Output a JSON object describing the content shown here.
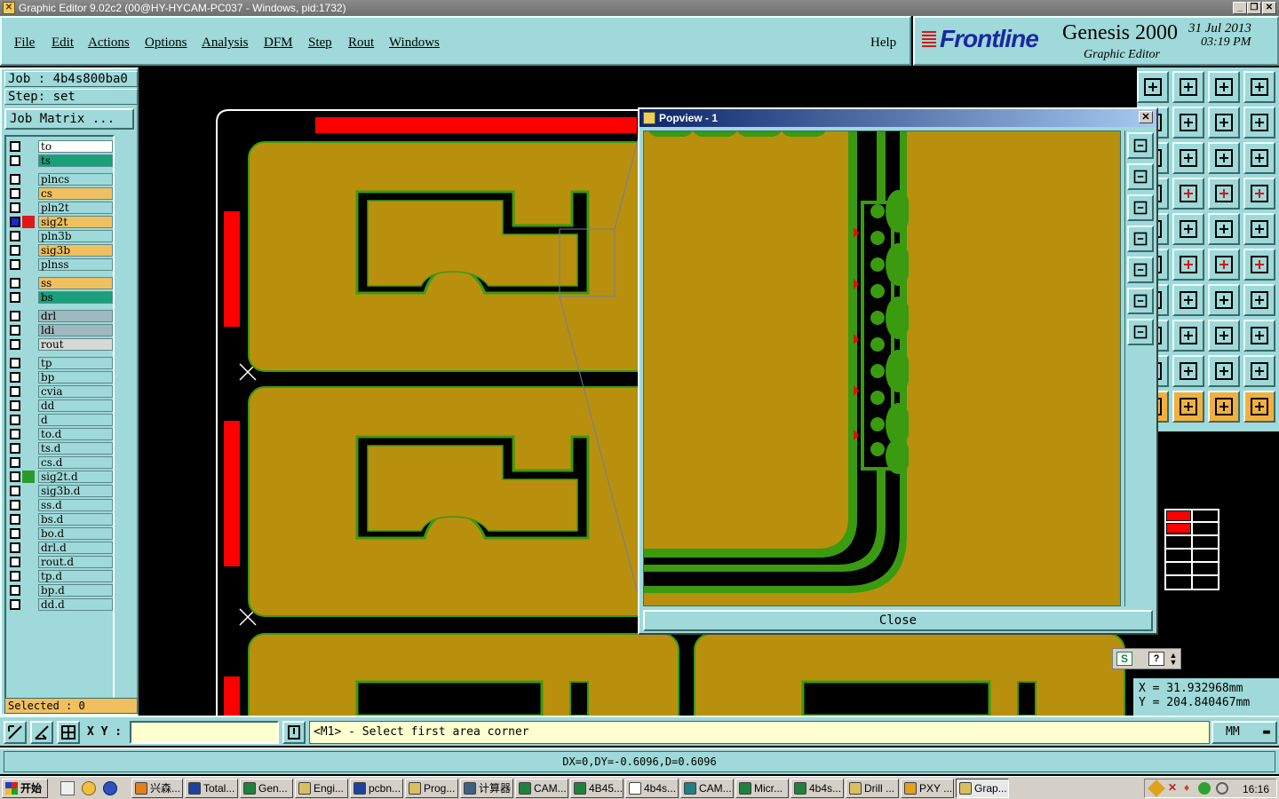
{
  "window": {
    "title": "Graphic Editor 9.02c2 (00@HY-HYCAM-PC037 - Windows, pid:1732)"
  },
  "menu": {
    "items": [
      {
        "label": "File"
      },
      {
        "label": "Edit"
      },
      {
        "label": "Actions"
      },
      {
        "label": "Options"
      },
      {
        "label": "Analysis"
      },
      {
        "label": "DFM"
      },
      {
        "label": "Step"
      },
      {
        "label": "Rout"
      },
      {
        "label": "Windows"
      }
    ],
    "help": "Help"
  },
  "brand": {
    "logo": "Frontline",
    "product": "Genesis 2000",
    "subtitle": "Graphic Editor",
    "date": "31 Jul 2013",
    "time": "03:19 PM"
  },
  "job": {
    "job_line": "Job : 4b4s800ba0",
    "step_line": "Step: set",
    "matrix_button": "Job Matrix ..."
  },
  "layers": [
    {
      "name": "to",
      "color": "#ffffff"
    },
    {
      "name": "ts",
      "color": "#1aa07a"
    },
    {
      "name": "plncs",
      "color": "#9fd9d9"
    },
    {
      "name": "cs",
      "color": "#f0c060"
    },
    {
      "name": "pln2t",
      "color": "#9fd9d9"
    },
    {
      "name": "sig2t",
      "color": "#f0c060"
    },
    {
      "name": "pln3b",
      "color": "#9fd9d9"
    },
    {
      "name": "sig3b",
      "color": "#f0c060"
    },
    {
      "name": "plnss",
      "color": "#9fd9d9"
    },
    {
      "name": "ss",
      "color": "#f0c060"
    },
    {
      "name": "bs",
      "color": "#1aa07a"
    },
    {
      "name": "drl",
      "color": "#a0b8c0"
    },
    {
      "name": "ldi",
      "color": "#a0b8c0"
    },
    {
      "name": "rout",
      "color": "#d8d8d8"
    },
    {
      "name": "tp",
      "color": "#9fd9d9"
    },
    {
      "name": "bp",
      "color": "#9fd9d9"
    },
    {
      "name": "cvia",
      "color": "#9fd9d9"
    },
    {
      "name": "dd",
      "color": "#9fd9d9"
    },
    {
      "name": "d",
      "color": "#9fd9d9"
    },
    {
      "name": "to.d",
      "color": "#9fd9d9"
    },
    {
      "name": "ts.d",
      "color": "#9fd9d9"
    },
    {
      "name": "cs.d",
      "color": "#9fd9d9"
    },
    {
      "name": "sig2t.d",
      "color": "#9fd9d9"
    },
    {
      "name": "sig3b.d",
      "color": "#9fd9d9"
    },
    {
      "name": "ss.d",
      "color": "#9fd9d9"
    },
    {
      "name": "bs.d",
      "color": "#9fd9d9"
    },
    {
      "name": "bo.d",
      "color": "#9fd9d9"
    },
    {
      "name": "drl.d",
      "color": "#9fd9d9"
    },
    {
      "name": "rout.d",
      "color": "#9fd9d9"
    },
    {
      "name": "tp.d",
      "color": "#9fd9d9"
    },
    {
      "name": "bp.d",
      "color": "#9fd9d9"
    },
    {
      "name": "dd.d",
      "color": "#9fd9d9"
    }
  ],
  "selected": "Selected : 0",
  "popview": {
    "title": "Popview - 1",
    "close_label": "Close"
  },
  "coords": {
    "x": "X  = 31.932968mm",
    "y": "Y  = 204.840467mm"
  },
  "command": {
    "xy_label": "X Y :",
    "xy_value": "",
    "prompt": "<M1> - Select first area corner",
    "units": "MM"
  },
  "measure": "DX=0,DY=-0.6096,D=0.6096",
  "taskbar": {
    "start": "开始",
    "tasks": [
      {
        "label": "兴森...",
        "color": "#e08020"
      },
      {
        "label": "Total...",
        "color": "#2040a0"
      },
      {
        "label": "Gen...",
        "color": "#208040"
      },
      {
        "label": "Engi...",
        "color": "#d8c060"
      },
      {
        "label": "pcbn...",
        "color": "#2040a0"
      },
      {
        "label": "Prog...",
        "color": "#d8c060"
      },
      {
        "label": "计算器",
        "color": "#406080"
      },
      {
        "label": "CAM...",
        "color": "#208040"
      },
      {
        "label": "4B45...",
        "color": "#208040"
      },
      {
        "label": "4b4s...",
        "color": "#ffffff"
      },
      {
        "label": "CAM...",
        "color": "#208080"
      },
      {
        "label": "Micr...",
        "color": "#208040"
      },
      {
        "label": "4b4s...",
        "color": "#208040"
      },
      {
        "label": "Drill ...",
        "color": "#d8c060"
      },
      {
        "label": "PXY ...",
        "color": "#e0a020"
      },
      {
        "label": "Grap...",
        "color": "#d8c060"
      }
    ],
    "clock": "16:16"
  },
  "colors": {
    "board_fill": "#b8900e",
    "trace_green": "#3a9a10",
    "panel_cyan": "#9fd9d9",
    "rail_red": "#ff0000"
  }
}
